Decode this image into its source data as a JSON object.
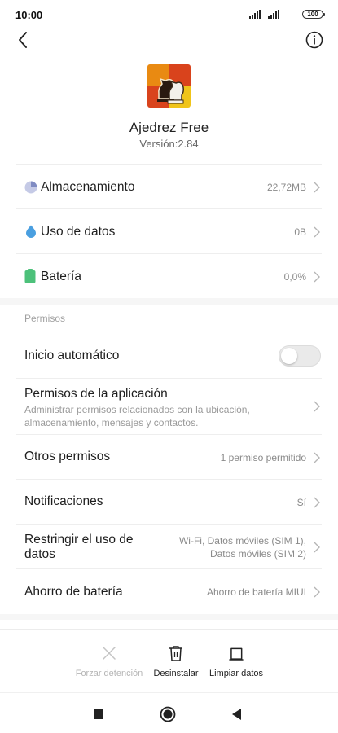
{
  "status_bar": {
    "time": "10:00",
    "battery": "100"
  },
  "app": {
    "name": "Ajedrez Free",
    "version": "Versión:2.84"
  },
  "usage": [
    {
      "title": "Almacenamiento",
      "value": "22,72MB",
      "icon": "storage-pie-icon"
    },
    {
      "title": "Uso de datos",
      "value": "0B",
      "icon": "data-drop-icon"
    },
    {
      "title": "Batería",
      "value": "0,0%",
      "icon": "battery-icon"
    }
  ],
  "permissions": {
    "section_label": "Permisos",
    "autostart": {
      "title": "Inicio automático",
      "enabled": false
    },
    "app_permissions": {
      "title": "Permisos de la aplicación",
      "subtitle_line1": "Administrar permisos relacionados con la ubicación,",
      "subtitle_line2": "almacenamiento, mensajes y contactos."
    },
    "other_permissions": {
      "title": "Otros permisos",
      "value": "1 permiso permitido"
    },
    "notifications": {
      "title": "Notificaciones",
      "value": "Sí"
    },
    "restrict_data": {
      "title_line1": "Restringir el uso de",
      "title_line2": "datos",
      "value_line1": "Wi-Fi, Datos móviles (SIM 1),",
      "value_line2": "Datos móviles (SIM 2)"
    },
    "battery_saver": {
      "title": "Ahorro de batería",
      "value": "Ahorro de batería MIUI"
    }
  },
  "actions": {
    "force_stop": "Forzar detención",
    "uninstall": "Desinstalar",
    "clear_data": "Limpiar datos"
  },
  "colors": {
    "storage_icon": "#9aa4cf",
    "data_icon": "#4a9fe0",
    "battery_icon": "#4cc17a",
    "disabled": "#b5b5b5"
  }
}
